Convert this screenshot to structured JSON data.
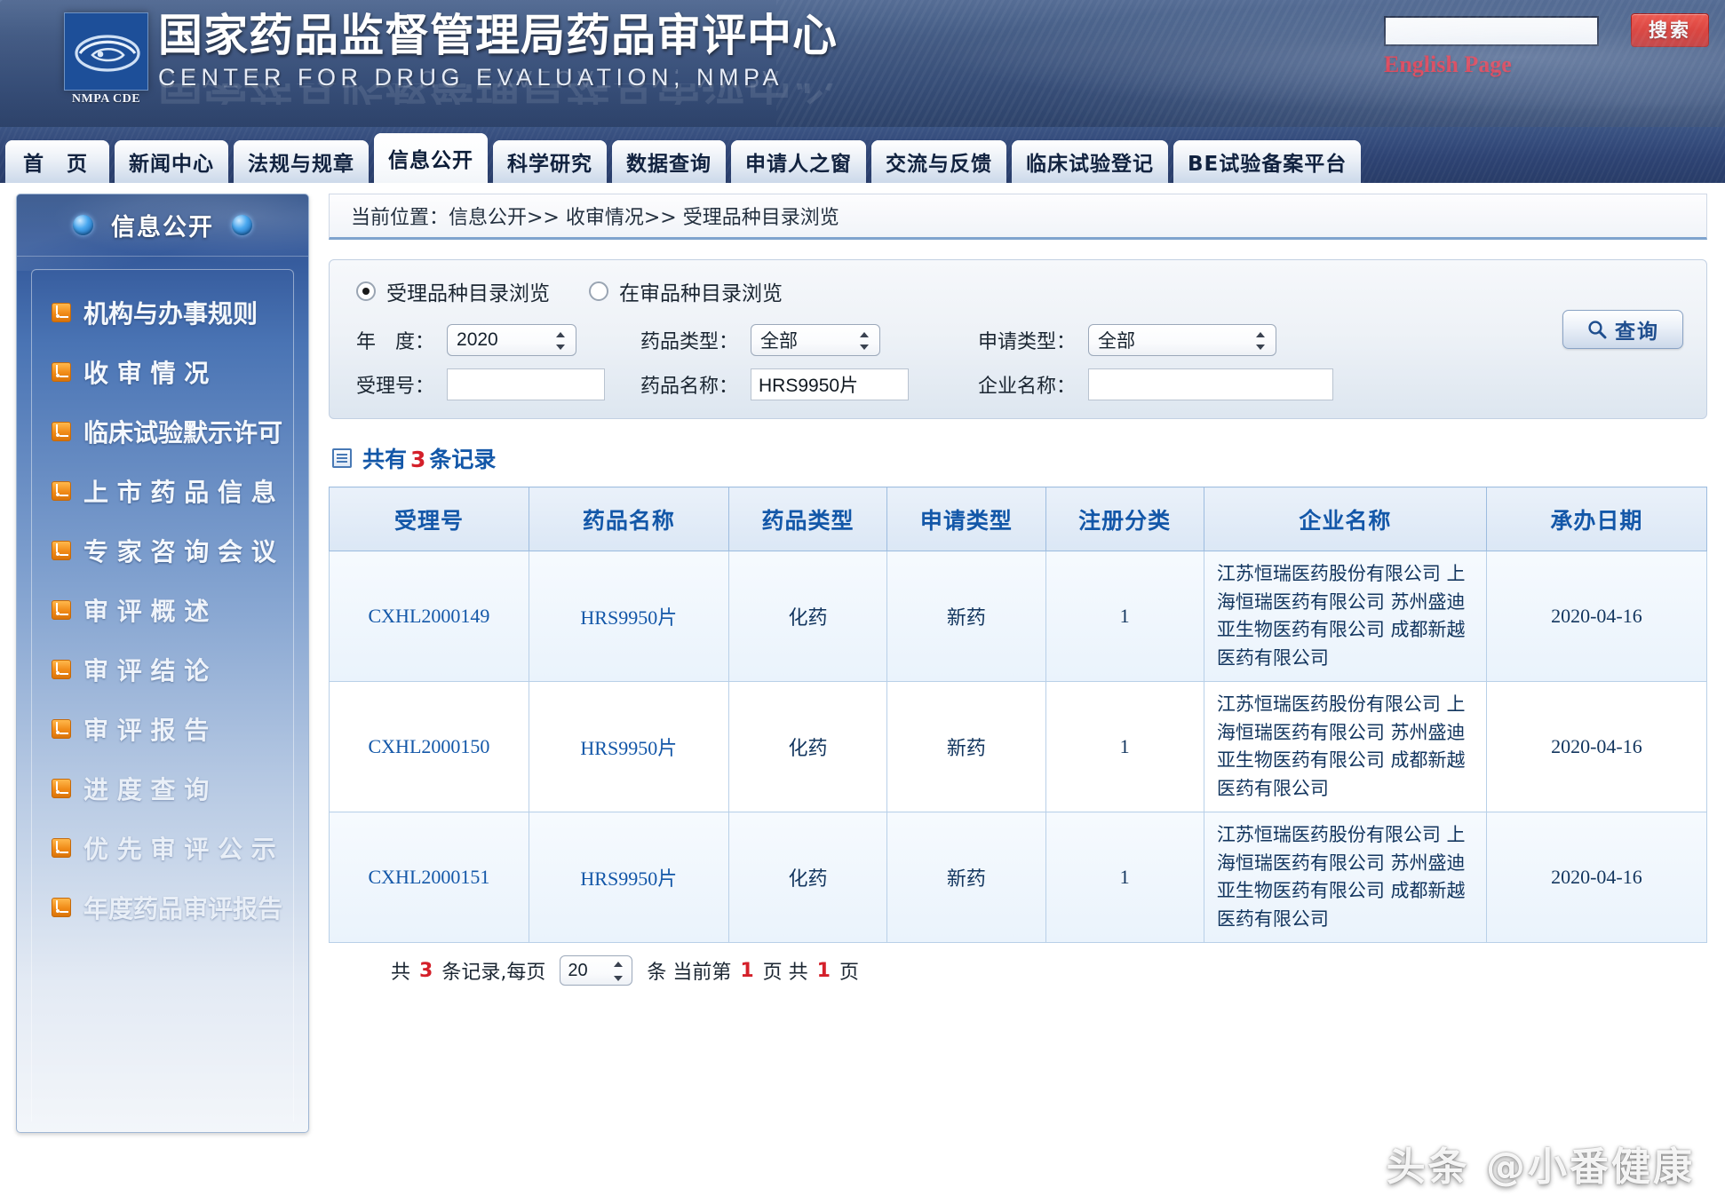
{
  "header": {
    "logo_caption": "NMPA CDE",
    "title_cn": "国家药品监督管理局药品审评中心",
    "title_en": "CENTER FOR DRUG EVALUATION, NMPA",
    "search_value": "",
    "search_placeholder": "",
    "search_button": "搜索",
    "english_link": "English Page"
  },
  "nav": {
    "tabs": [
      {
        "label": "首  页",
        "active": false
      },
      {
        "label": "新闻中心",
        "active": false
      },
      {
        "label": "法规与规章",
        "active": false
      },
      {
        "label": "信息公开",
        "active": true
      },
      {
        "label": "科学研究",
        "active": false
      },
      {
        "label": "数据查询",
        "active": false
      },
      {
        "label": "申请人之窗",
        "active": false
      },
      {
        "label": "交流与反馈",
        "active": false
      },
      {
        "label": "临床试验登记",
        "active": false
      },
      {
        "label": "BE试验备案平台",
        "active": false
      }
    ]
  },
  "sidebar": {
    "title": "信息公开",
    "items": [
      {
        "label": "机构与办事规则"
      },
      {
        "label": "收  审  情  况"
      },
      {
        "label": "临床试验默示许可"
      },
      {
        "label": "上 市 药 品 信 息"
      },
      {
        "label": "专 家 咨 询 会 议"
      },
      {
        "label": "审  评  概  述"
      },
      {
        "label": "审  评  结  论"
      },
      {
        "label": "审  评  报  告"
      },
      {
        "label": "进  度  查  询"
      },
      {
        "label": "优 先 审 评 公 示"
      },
      {
        "label": "年度药品审评报告"
      }
    ]
  },
  "breadcrumb": {
    "text": "当前位置：信息公开>> 收审情况>> 受理品种目录浏览"
  },
  "query_form": {
    "radios": [
      {
        "label": "受理品种目录浏览",
        "selected": true
      },
      {
        "label": "在审品种目录浏览",
        "selected": false
      }
    ],
    "year_label": "年　度：",
    "year_value": "2020",
    "drug_type_label": "药品类型：",
    "drug_type_value": "全部",
    "apply_type_label": "申请类型：",
    "apply_type_value": "全部",
    "accept_no_label": "受理号：",
    "accept_no_value": "",
    "drug_name_label": "药品名称：",
    "drug_name_value": "HRS9950片",
    "firm_label": "企业名称：",
    "firm_value": "",
    "query_button": "查询"
  },
  "results": {
    "summary_prefix": "共有",
    "summary_count": "3",
    "summary_suffix": "条记录",
    "columns": [
      "受理号",
      "药品名称",
      "药品类型",
      "申请类型",
      "注册分类",
      "企业名称",
      "承办日期"
    ],
    "rows": [
      {
        "accept_no": "CXHL2000149",
        "drug_name": "HRS9950片",
        "drug_type": "化药",
        "apply_type": "新药",
        "reg_class": "1",
        "firm": "江苏恒瑞医药股份有限公司 上海恒瑞医药有限公司 苏州盛迪亚生物医药有限公司 成都新越医药有限公司",
        "date": "2020-04-16"
      },
      {
        "accept_no": "CXHL2000150",
        "drug_name": "HRS9950片",
        "drug_type": "化药",
        "apply_type": "新药",
        "reg_class": "1",
        "firm": "江苏恒瑞医药股份有限公司 上海恒瑞医药有限公司 苏州盛迪亚生物医药有限公司 成都新越医药有限公司",
        "date": "2020-04-16"
      },
      {
        "accept_no": "CXHL2000151",
        "drug_name": "HRS9950片",
        "drug_type": "化药",
        "apply_type": "新药",
        "reg_class": "1",
        "firm": "江苏恒瑞医药股份有限公司 上海恒瑞医药有限公司 苏州盛迪亚生物医药有限公司 成都新越医药有限公司",
        "date": "2020-04-16"
      }
    ]
  },
  "pager": {
    "t1": "共",
    "count": "3",
    "t2": "条记录,每页",
    "page_size": "20",
    "t3": "条 当前第",
    "current_page": "1",
    "t4": "页 共",
    "total_pages": "1",
    "t5": "页"
  },
  "watermark": "头条 @小番健康",
  "colors": {
    "header_blue": "#3c5480",
    "accent_blue": "#1357a8",
    "red": "#d4202a",
    "orange": "#f08a17"
  }
}
